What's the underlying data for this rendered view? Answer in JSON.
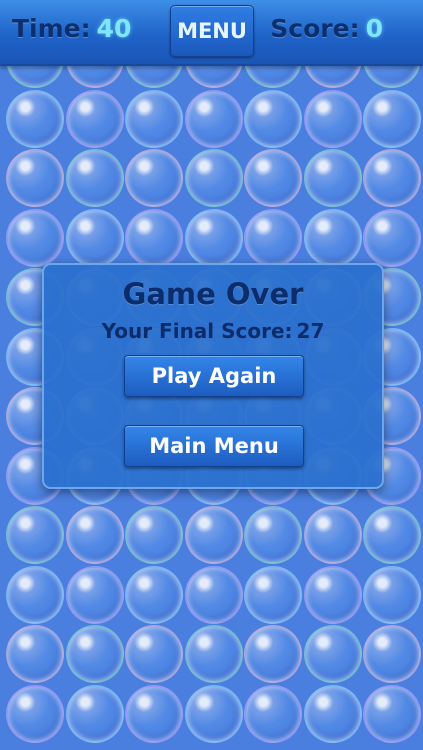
{
  "hud": {
    "time_label": "Time:",
    "time_value": "40",
    "menu_label": "MENU",
    "score_label": "Score:",
    "score_value": "0"
  },
  "game_over": {
    "title": "Game Over",
    "final_score_label": "Your Final Score:",
    "final_score_value": "27",
    "play_again_label": "Play Again",
    "main_menu_label": "Main Menu"
  },
  "board": {
    "columns": 7,
    "rows": 12
  },
  "colors": {
    "background": "#4a7fe0",
    "header": "#1f63c9",
    "hud_value": "#7fe6ff",
    "dark_text": "#0d2c6a",
    "modal": "#2a70ce"
  }
}
